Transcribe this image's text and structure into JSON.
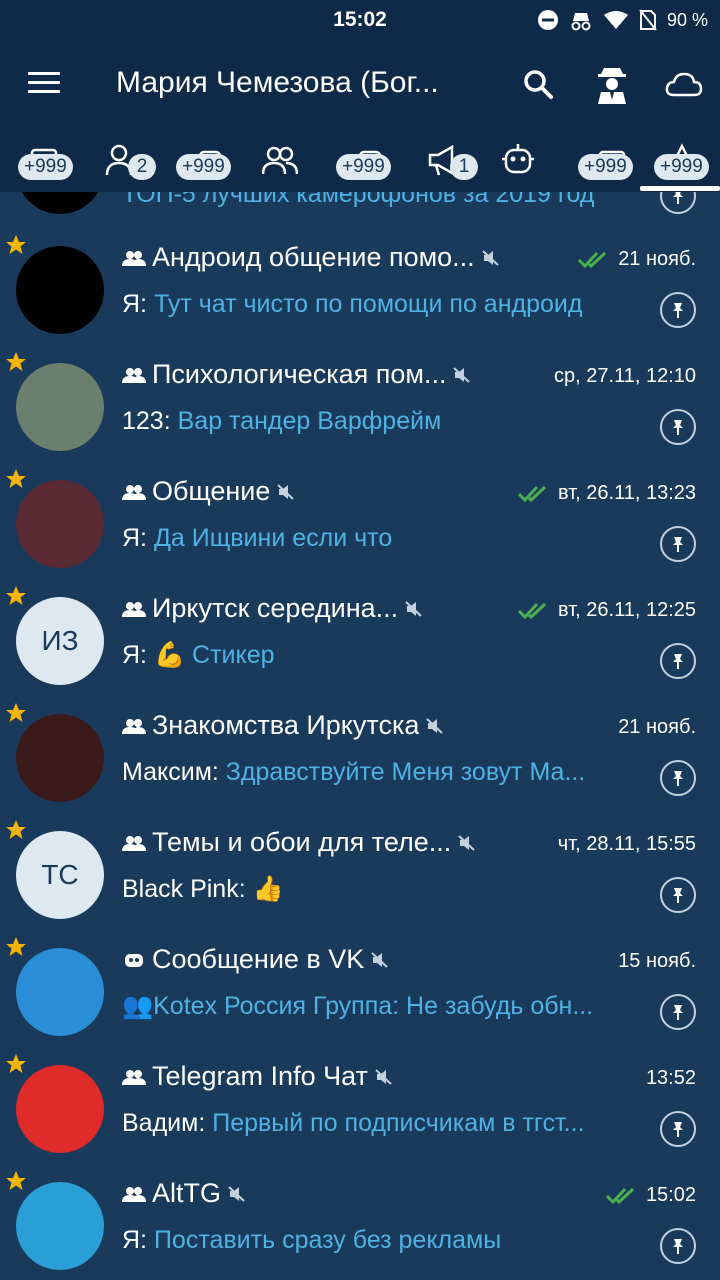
{
  "status": {
    "time": "15:02",
    "battery": "90 %"
  },
  "header": {
    "title": "Мария Чемезова (Бог..."
  },
  "tabs": [
    {
      "name": "tab-all",
      "badge": "+999"
    },
    {
      "name": "tab-users",
      "badge": "2"
    },
    {
      "name": "tab-bots",
      "badge": "+999"
    },
    {
      "name": "tab-groups",
      "badge": ""
    },
    {
      "name": "tab-supergroups",
      "badge": "+999"
    },
    {
      "name": "tab-channels",
      "badge": "1"
    },
    {
      "name": "tab-robots",
      "badge": ""
    },
    {
      "name": "tab-unread",
      "badge": "+999"
    },
    {
      "name": "tab-admin",
      "badge": "+999"
    }
  ],
  "partial_row": {
    "message": "ТОП-5 лучших камерофонов за 2019 год"
  },
  "chats": [
    {
      "name": "Андроид общение помо...",
      "sender": "Я: ",
      "message": "Тут чат чисто по помощи по андроид",
      "date": "21 нояб.",
      "read": true,
      "avatar_text": "",
      "avatar_color": "#000000"
    },
    {
      "name": "Психологическая пом...",
      "sender": "123: ",
      "message": "Вар тандер Варфрейм",
      "date": "ср, 27.11, 12:10",
      "read": false,
      "avatar_text": "",
      "avatar_color": "#6b7f6e"
    },
    {
      "name": "Общение",
      "sender": "Я: ",
      "message": "Да Ищвини если что",
      "date": "вт, 26.11, 13:23",
      "read": true,
      "avatar_text": "",
      "avatar_color": "#5a2a34"
    },
    {
      "name": "Иркутск середина...",
      "sender": "Я: ",
      "message": "💪 Стикер",
      "date": "вт, 26.11, 12:25",
      "read": true,
      "avatar_text": "ИЗ",
      "avatar_color": "#dde8f0"
    },
    {
      "name": "Знакомства Иркутска",
      "sender": "Максим: ",
      "message": "Здравствуйте Меня зовут Ма...",
      "date": "21 нояб.",
      "read": false,
      "avatar_text": "",
      "avatar_color": "#3a1a1a"
    },
    {
      "name": "Темы и обои для теле...",
      "sender": "Black Pink: ",
      "message": "👍",
      "date": "чт, 28.11, 15:55",
      "read": false,
      "avatar_text": "ТС",
      "avatar_color": "#dde8f0"
    },
    {
      "name": "Сообщение в VK",
      "sender": "",
      "message": "👥Kotex Россия Группа: Не забудь обн...",
      "date": "15 нояб.",
      "read": false,
      "avatar_text": "",
      "avatar_color": "#2a8fd6"
    },
    {
      "name": "Telegram Info Чат",
      "sender": "Вадим: ",
      "message": "Первый по подписчикам в тгст...",
      "date": "13:52",
      "read": false,
      "avatar_text": "",
      "avatar_color": "#e02b2b"
    },
    {
      "name": "AltTG",
      "sender": "Я: ",
      "message": "Поставить сразу без рекламы",
      "date": "15:02",
      "read": true,
      "avatar_text": "",
      "avatar_color": "#2a9fd6"
    }
  ],
  "colors": {
    "background": "#1a3a5c",
    "header": "#0e2a48",
    "accent": "#4fb2e3",
    "star": "#f5b400",
    "check": "#4caf50"
  }
}
